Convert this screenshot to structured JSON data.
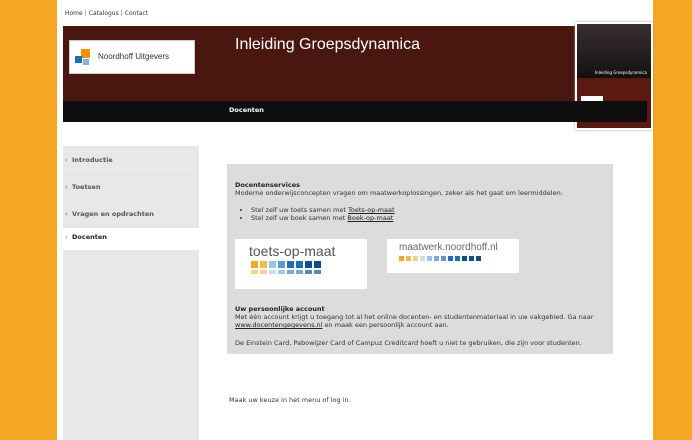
{
  "topnav": {
    "home": "Home",
    "sep": "|",
    "catalogus": "Catalogus",
    "contact": "Contact"
  },
  "header": {
    "logo_text": "Noordhoff Uitgevers",
    "title": "Inleiding Groepsdynamica",
    "section": "Docenten",
    "book_title": "Inleiding Groepsdynamica"
  },
  "sidebar": {
    "items": [
      {
        "label": "Introductie"
      },
      {
        "label": "Toetsen"
      },
      {
        "label": "Vragen en opdrachten"
      },
      {
        "label": "Docenten"
      }
    ]
  },
  "main": {
    "services_title": "Docentenservices",
    "services_intro": "Moderne onderwijsconcepten vragen om maatwerkoplossingen, zeker als het gaat om leermiddelen:",
    "bullet1_text": "Stel zelf uw toets samen met ",
    "bullet1_link": "Toets-op-maat",
    "bullet2_text": "Stel zelf uw boek samen met ",
    "bullet2_link": "Boek-op-maat",
    "badge1": "toets-op-maat",
    "badge2": "maatwerk.noordhoff.nl",
    "account_title": "Uw persoonlijke account",
    "account_text1": "Met één account krijgt u toegang tot al het online docenten- en studentenmateriaal in uw vakgebied. Ga naar ",
    "account_link": "www.docentengegevens.nl",
    "account_text2": " en maak een persoonlijk account aan.",
    "account_note": "De Einstein Card, Pabowijzer Card of Campuz Creditcard hoeft u niet te gebruiken, die zijn voor studenten.",
    "footer_text": "Maak uw keuze in het menu of log in."
  },
  "colors": {
    "background": "#f5a623",
    "header": "#4a1610",
    "bar": "#0e0e0e",
    "sidebar": "#e8e8e8",
    "box": "#dcdcdc"
  }
}
